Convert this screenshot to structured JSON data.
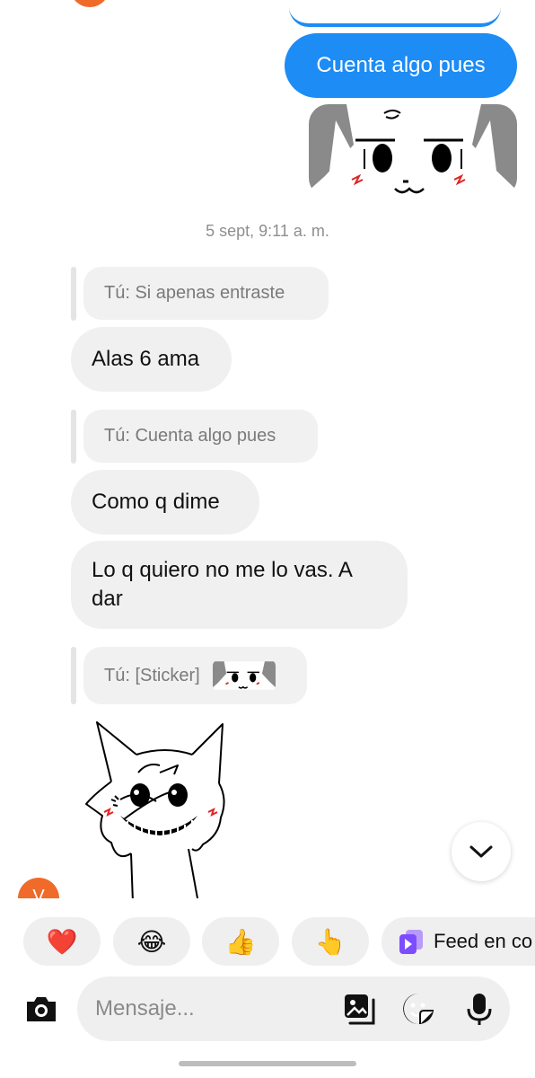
{
  "thread": {
    "outgoing_text": "Cuenta algo pues",
    "timestamp": "5 sept, 9:11 a. m."
  },
  "messages": [
    {
      "reply_to": "Tú: Si apenas entraste",
      "text": "Alas 6 ama"
    },
    {
      "reply_to": "Tú: Cuenta algo pues",
      "text": "Como q dime"
    },
    {
      "text": "Lo q quiero no me lo vas. A dar"
    },
    {
      "reply_to": "Tú: [Sticker]"
    }
  ],
  "avatar": {
    "initial": "V",
    "color": "#f06a2a"
  },
  "reactions": [
    {
      "emoji": "❤️",
      "icon": "red-heart-icon"
    },
    {
      "emoji": "😂",
      "icon": "tears-of-joy-icon"
    },
    {
      "emoji": "👍",
      "icon": "thumbs-up-icon"
    },
    {
      "emoji": "👆",
      "icon": "pointing-up-icon"
    }
  ],
  "feed_button": {
    "label": "Feed en co"
  },
  "composer": {
    "placeholder": "Mensaje..."
  },
  "colors": {
    "accent": "#1d8cf5",
    "bubble_in": "#f0f0f0",
    "feed_icon": "#8b5cf6"
  }
}
